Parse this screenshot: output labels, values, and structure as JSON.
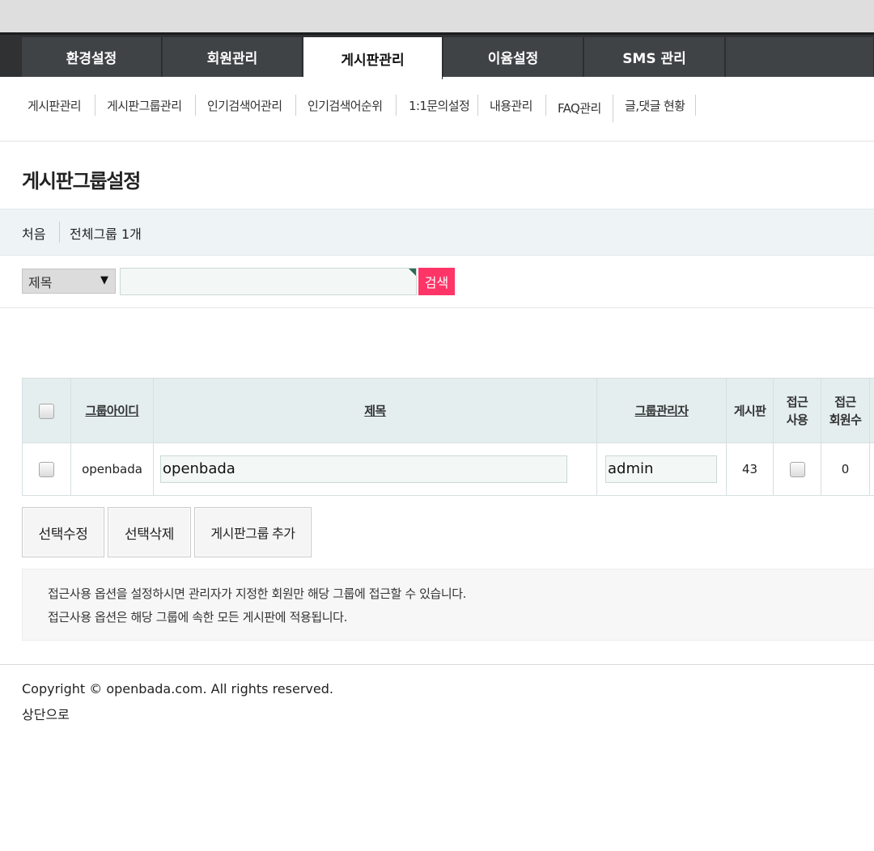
{
  "main_nav": {
    "tabs": [
      {
        "label": "환경설정"
      },
      {
        "label": "회원관리"
      },
      {
        "label": "게시판관리"
      },
      {
        "label": "이윰설정"
      },
      {
        "label": "SMS 관리"
      }
    ],
    "active": "게시판관리"
  },
  "sub_nav": {
    "items": [
      {
        "label": "게시판관리"
      },
      {
        "label": "게시판그룹관리"
      },
      {
        "label": "인기검색어관리"
      },
      {
        "label": "인기검색어순위"
      },
      {
        "label": "1:1문의설정"
      },
      {
        "label": "내용관리"
      },
      {
        "label": "FAQ관리"
      },
      {
        "label": "글,댓글 현황"
      }
    ]
  },
  "page": {
    "title": "게시판그룹설정"
  },
  "info_bar": {
    "first": "처음",
    "total": "전체그룹 1개"
  },
  "search": {
    "field_selected": "제목",
    "query": "",
    "button": "검색"
  },
  "table": {
    "headers": {
      "group_id": "그룹아이디",
      "title": "제목",
      "group_admin": "그룹관리자",
      "boards": "게시판",
      "access_use_1": "접근",
      "access_use_2": "사용",
      "access_members_1": "접근",
      "access_members_2": "회원수"
    },
    "rows": [
      {
        "group_id": "openbada",
        "title": "openbada",
        "group_admin": "admin",
        "boards": "43",
        "access_members": "0"
      }
    ]
  },
  "actions": {
    "edit_selected": "선택수정",
    "delete_selected": "선택삭제",
    "add_group": "게시판그룹 추가"
  },
  "notice": {
    "line1": "접근사용 옵션을 설정하시면 관리자가 지정한 회원만 해당 그룹에 접근할 수 있습니다.",
    "line2": "접근사용 옵션은 해당 그룹에 속한 모든 게시판에 적용됩니다."
  },
  "footer": {
    "copyright": "Copyright © openbada.com. All rights reserved.",
    "to_top": "상단으로"
  }
}
